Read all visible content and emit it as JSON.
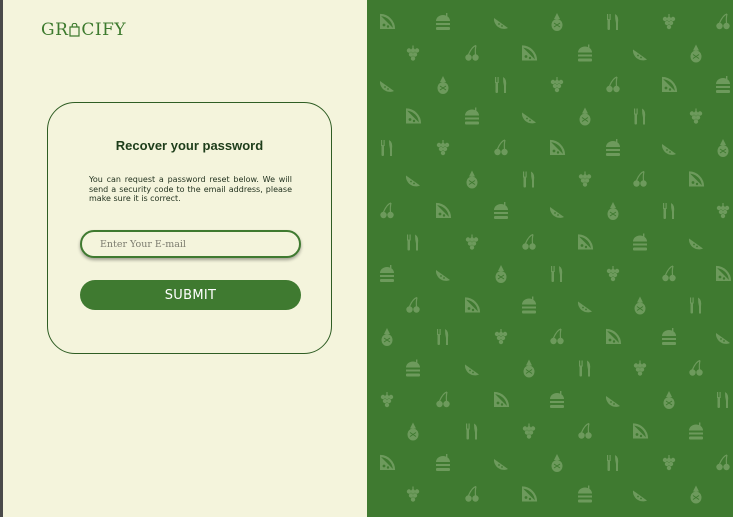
{
  "brand": {
    "name_part1": "GR",
    "name_part2": "CIFY",
    "logo_icon": "shopping-bag-icon"
  },
  "recover": {
    "title": "Recover your password",
    "description": "You can request a password reset below. We will send a security code to the email address, please make sure it is correct.",
    "email_placeholder": "Enter Your E-mail",
    "email_value": "",
    "submit_label": "SUBMIT"
  },
  "theme": {
    "left_bg": "#f4f4dc",
    "right_bg": "#3f7a30",
    "pattern_color": "#6d9a5c",
    "accent": "#3f7a30"
  },
  "pattern": {
    "icons": [
      "pizza-icon",
      "grapes-icon",
      "pineapple-icon",
      "burger-icon",
      "cherries-icon",
      "cutlery-icon",
      "watermelon-icon"
    ]
  }
}
